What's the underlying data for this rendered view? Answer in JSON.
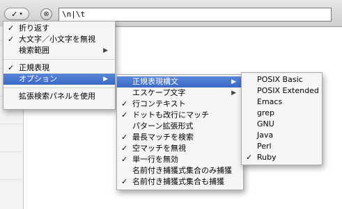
{
  "search": {
    "value": "\\n|\\t"
  },
  "toolbar": {
    "options_check": "✓",
    "options_chevron": "▾",
    "clear_symbol": "⊗"
  },
  "main_menu": {
    "items": [
      {
        "label": "折り返す",
        "checked": true
      },
      {
        "label": "大文字／小文字を無視",
        "checked": true
      },
      {
        "label": "検索範囲",
        "checked": false,
        "submenu": true
      },
      {
        "label": "正規表現",
        "checked": true
      },
      {
        "label": "オプション",
        "checked": false,
        "submenu": true,
        "selected": true
      },
      {
        "label": "拡張検索パネルを使用",
        "checked": false
      }
    ]
  },
  "options_menu": {
    "items": [
      {
        "label": "正規表現構文",
        "checked": false,
        "submenu": true,
        "selected": true
      },
      {
        "label": "エスケープ文字",
        "checked": false,
        "submenu": true
      },
      {
        "label": "行コンテキスト",
        "checked": true
      },
      {
        "label": "ドットも改行にマッチ",
        "checked": true
      },
      {
        "label": "パターン拡張形式",
        "checked": false
      },
      {
        "label": "最長マッチを検索",
        "checked": true
      },
      {
        "label": "空マッチを無視",
        "checked": true
      },
      {
        "label": "単一行を無効",
        "checked": true
      },
      {
        "label": "名前付き捕獲式集合のみ捕獲",
        "checked": false
      },
      {
        "label": "名前付き捕獲式集合も捕獲",
        "checked": true
      }
    ]
  },
  "syntax_menu": {
    "items": [
      {
        "label": "POSIX Basic",
        "checked": false
      },
      {
        "label": "POSIX Extended",
        "checked": false
      },
      {
        "label": "Emacs",
        "checked": false
      },
      {
        "label": "grep",
        "checked": false
      },
      {
        "label": "GNU",
        "checked": false
      },
      {
        "label": "Java",
        "checked": false
      },
      {
        "label": "Perl",
        "checked": false
      },
      {
        "label": "Ruby",
        "checked": true
      }
    ]
  },
  "symbols": {
    "check": "✓",
    "arrow": "▶"
  },
  "colors": {
    "selection": "#3a68c6",
    "menu_bg": "#f6f6f6"
  }
}
